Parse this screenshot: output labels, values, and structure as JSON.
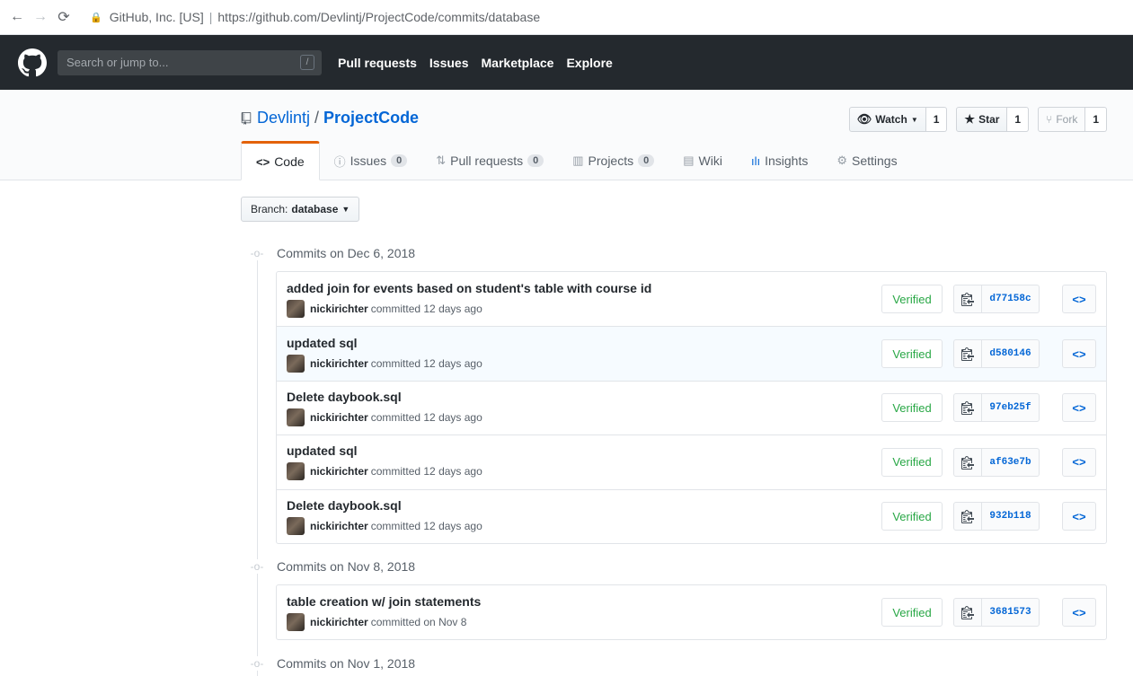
{
  "browser": {
    "back": "←",
    "forward": "→",
    "reload": "C",
    "site_identity": "GitHub, Inc. [US]",
    "url": "https://github.com/Devlintj/ProjectCode/commits/database"
  },
  "header": {
    "search_placeholder": "Search or jump to...",
    "search_shortcut": "/",
    "nav": [
      "Pull requests",
      "Issues",
      "Marketplace",
      "Explore"
    ]
  },
  "repo": {
    "owner": "Devlintj",
    "separator": "/",
    "name": "ProjectCode",
    "watch": {
      "label": "Watch",
      "count": "1"
    },
    "star": {
      "label": "Star",
      "count": "1"
    },
    "fork": {
      "label": "Fork",
      "count": "1"
    },
    "tabs": [
      {
        "icon": "code-icon",
        "label": "Code"
      },
      {
        "icon": "issue-icon",
        "label": "Issues",
        "count": "0"
      },
      {
        "icon": "pull-request-icon",
        "label": "Pull requests",
        "count": "0"
      },
      {
        "icon": "project-icon",
        "label": "Projects",
        "count": "0"
      },
      {
        "icon": "wiki-icon",
        "label": "Wiki"
      },
      {
        "icon": "insights-icon",
        "label": "Insights"
      },
      {
        "icon": "gear-icon",
        "label": "Settings"
      }
    ]
  },
  "branch": {
    "prefix": "Branch:",
    "name": "database"
  },
  "groups": [
    {
      "date": "Commits on Dec 6, 2018",
      "commits": [
        {
          "message": "added join for events based on student's table with course id",
          "author": "nickirichter",
          "when": "committed 12 days ago",
          "verified": "Verified",
          "sha": "d77158c"
        },
        {
          "message": "updated sql",
          "author": "nickirichter",
          "when": "committed 12 days ago",
          "verified": "Verified",
          "sha": "d580146"
        },
        {
          "message": "Delete daybook.sql",
          "author": "nickirichter",
          "when": "committed 12 days ago",
          "verified": "Verified",
          "sha": "97eb25f"
        },
        {
          "message": "updated sql",
          "author": "nickirichter",
          "when": "committed 12 days ago",
          "verified": "Verified",
          "sha": "af63e7b"
        },
        {
          "message": "Delete daybook.sql",
          "author": "nickirichter",
          "when": "committed 12 days ago",
          "verified": "Verified",
          "sha": "932b118"
        }
      ]
    },
    {
      "date": "Commits on Nov 8, 2018",
      "commits": [
        {
          "message": "table creation w/ join statements",
          "author": "nickirichter",
          "when": "committed on Nov 8",
          "verified": "Verified",
          "sha": "3681573"
        }
      ]
    },
    {
      "date": "Commits on Nov 1, 2018",
      "commits": []
    }
  ],
  "colors": {
    "header_bg": "#24292e",
    "link": "#0366d6",
    "verified": "#28a745",
    "tab_accent": "#e36209"
  }
}
